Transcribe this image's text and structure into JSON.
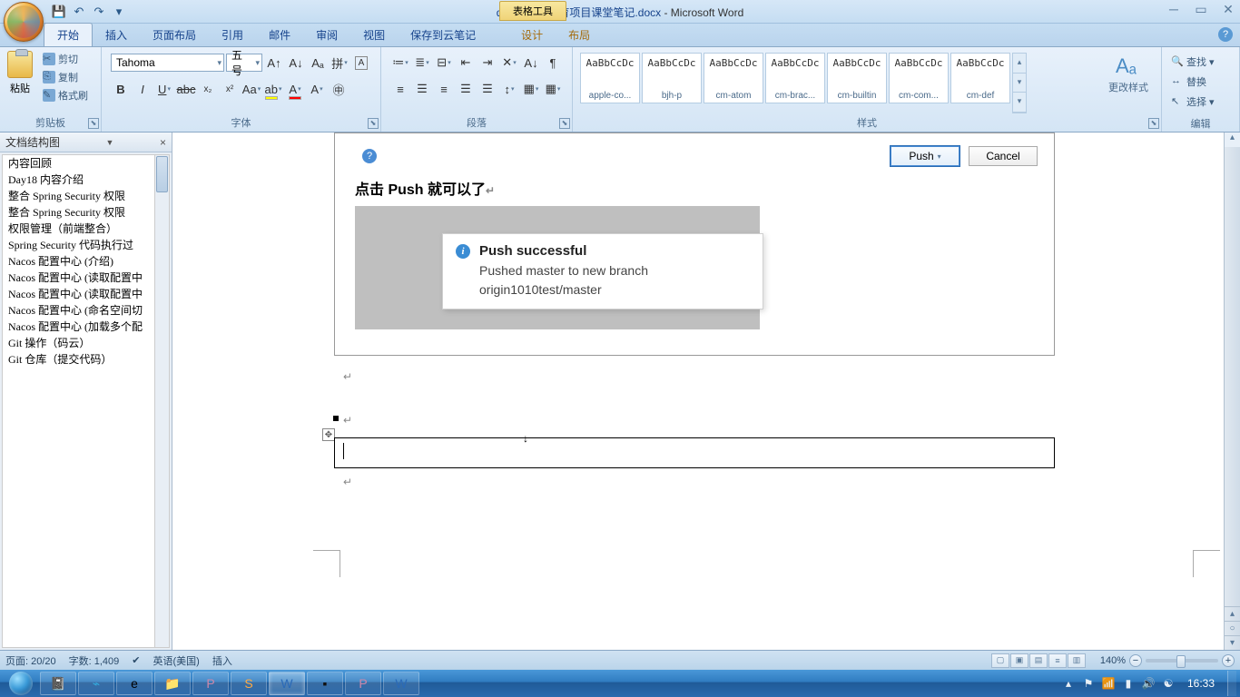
{
  "title": {
    "document": "day18在线教育项目课堂笔记.docx",
    "app": "Microsoft Word",
    "contextual_tab": "表格工具"
  },
  "qat": {
    "save": "💾",
    "undo": "↶",
    "redo": "↷",
    "more": "▾"
  },
  "tabs": {
    "home": "开始",
    "insert": "插入",
    "pagelayout": "页面布局",
    "references": "引用",
    "mailings": "邮件",
    "review": "审阅",
    "view": "视图",
    "cloud": "保存到云笔记",
    "design": "设计",
    "layout": "布局"
  },
  "ribbon": {
    "clipboard": {
      "paste": "粘贴",
      "cut": "剪切",
      "copy": "复制",
      "format_painter": "格式刷",
      "label": "剪贴板"
    },
    "font": {
      "name": "Tahoma",
      "size": "五号",
      "label": "字体"
    },
    "paragraph": {
      "label": "段落"
    },
    "styles": {
      "label": "样式",
      "change": "更改样式",
      "items": [
        {
          "preview": "AaBbCcDc",
          "name": "apple-co..."
        },
        {
          "preview": "AaBbCcDc",
          "name": "bjh-p"
        },
        {
          "preview": "AaBbCcDc",
          "name": "cm-atom"
        },
        {
          "preview": "AaBbCcDc",
          "name": "cm-brac..."
        },
        {
          "preview": "AaBbCcDc",
          "name": "cm-builtin"
        },
        {
          "preview": "AaBbCcDc",
          "name": "cm-com..."
        },
        {
          "preview": "AaBbCcDc",
          "name": "cm-def"
        }
      ]
    },
    "editing": {
      "find": "查找",
      "replace": "替换",
      "select": "选择",
      "label": "编辑"
    }
  },
  "navpane": {
    "title": "文档结构图",
    "items": [
      "内容回顾",
      "Day18 内容介绍",
      "整合 Spring Security 权限",
      "整合 Spring Security 权限",
      "权限管理（前端整合）",
      "Spring Security 代码执行过",
      "Nacos 配置中心 (介绍)",
      "Nacos 配置中心 (读取配置中",
      "Nacos 配置中心 (读取配置中",
      "Nacos 配置中心 (命名空间切",
      "Nacos 配置中心 (加载多个配",
      "Git 操作（码云）",
      "Git 仓库（提交代码）"
    ]
  },
  "document": {
    "push_btn": "Push",
    "cancel_btn": "Cancel",
    "heading": "点击 Push 就可以了",
    "popup_title": "Push successful",
    "popup_body1": "Pushed master to new branch",
    "popup_body2": "origin1010test/master"
  },
  "status": {
    "page": "页面: 20/20",
    "words": "字数: 1,409",
    "lang": "英语(美国)",
    "mode": "插入",
    "zoom": "140%"
  },
  "tray": {
    "time": "16:33"
  }
}
